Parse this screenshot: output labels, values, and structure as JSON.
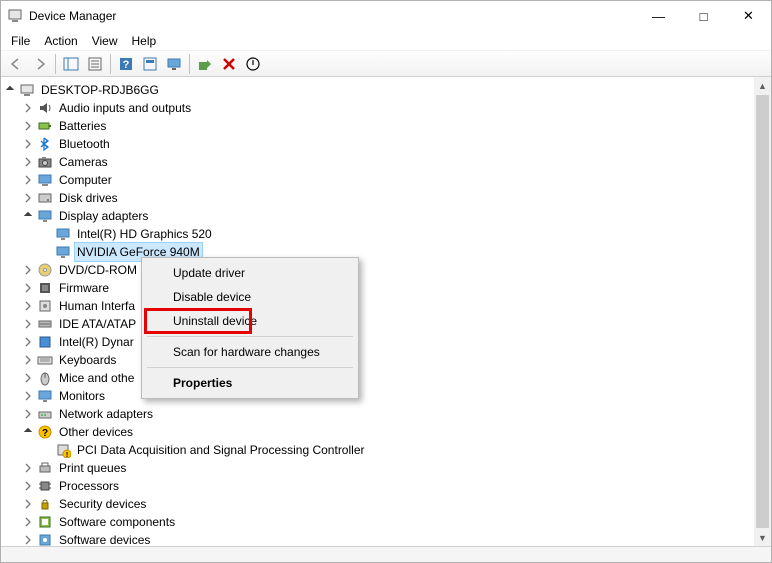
{
  "window": {
    "title": "Device Manager"
  },
  "menubar": [
    "File",
    "Action",
    "View",
    "Help"
  ],
  "toolbar": {
    "back": "back-icon",
    "forward": "forward-icon"
  },
  "tree": {
    "root": "DESKTOP-RDJB6GG",
    "nodes": [
      {
        "label": "Audio inputs and outputs",
        "icon": "audio"
      },
      {
        "label": "Batteries",
        "icon": "battery"
      },
      {
        "label": "Bluetooth",
        "icon": "bluetooth"
      },
      {
        "label": "Cameras",
        "icon": "camera"
      },
      {
        "label": "Computer",
        "icon": "computer"
      },
      {
        "label": "Disk drives",
        "icon": "disk"
      },
      {
        "label": "Display adapters",
        "icon": "display",
        "expanded": true,
        "children": [
          {
            "label": "Intel(R) HD Graphics 520",
            "icon": "display"
          },
          {
            "label": "NVIDIA GeForce 940M",
            "icon": "display",
            "selected": true
          }
        ]
      },
      {
        "label": "DVD/CD-ROM",
        "icon": "dvd",
        "truncated": true
      },
      {
        "label": "Firmware",
        "icon": "firmware"
      },
      {
        "label": "Human Interfa",
        "icon": "hid",
        "truncated": true
      },
      {
        "label": "IDE ATA/ATAP",
        "icon": "ide",
        "truncated": true
      },
      {
        "label": "Intel(R) Dynar",
        "icon": "intel",
        "truncated": true
      },
      {
        "label": "Keyboards",
        "icon": "keyboard"
      },
      {
        "label": "Mice and othe",
        "icon": "mouse",
        "truncated": true
      },
      {
        "label": "Monitors",
        "icon": "monitor"
      },
      {
        "label": "Network adapters",
        "icon": "network"
      },
      {
        "label": "Other devices",
        "icon": "other",
        "expanded": true,
        "children": [
          {
            "label": "PCI Data Acquisition and Signal Processing Controller",
            "icon": "unknown"
          }
        ]
      },
      {
        "label": "Print queues",
        "icon": "printer"
      },
      {
        "label": "Processors",
        "icon": "cpu"
      },
      {
        "label": "Security devices",
        "icon": "security"
      },
      {
        "label": "Software components",
        "icon": "swcomp"
      },
      {
        "label": "Software devices",
        "icon": "swdev",
        "truncated": true
      }
    ]
  },
  "context_menu": {
    "items": [
      {
        "label": "Update driver"
      },
      {
        "label": "Disable device"
      },
      {
        "label": "Uninstall device",
        "highlight": true
      },
      {
        "sep": true
      },
      {
        "label": "Scan for hardware changes"
      },
      {
        "sep": true
      },
      {
        "label": "Properties",
        "bold": true
      }
    ]
  }
}
